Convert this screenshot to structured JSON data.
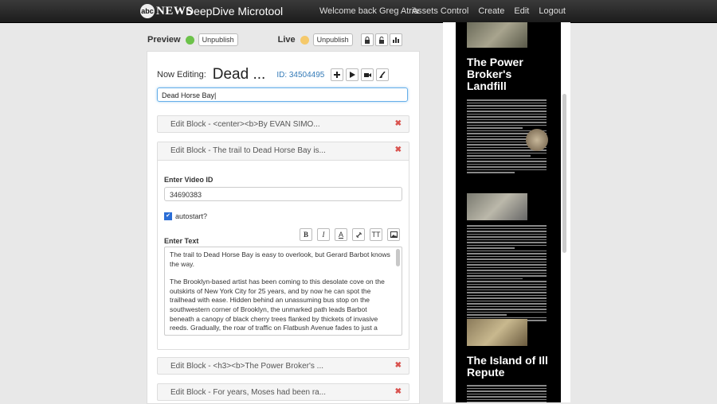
{
  "topbar": {
    "logo_mark": "abc",
    "logo_text": "NEWS",
    "app_title": "DeepDive Microtool",
    "welcome": "Welcome back Greg Atria",
    "nav": [
      "Assets Control",
      "Create",
      "Edit",
      "Logout"
    ]
  },
  "status": {
    "preview_label": "Preview",
    "preview_color": "#6cc24a",
    "live_label": "Live",
    "live_color": "#f5c96b",
    "unpublish_label": "Unpublish"
  },
  "editor": {
    "now_editing_label": "Now Editing:",
    "title_short": "Dead ...",
    "id_label": "ID: 34504495",
    "title_value": "Dead Horse Bay|"
  },
  "blocks": [
    {
      "label": "Edit Block - <center><b>By EVAN SIMO..."
    },
    {
      "label": "Edit Block - The trail to Dead Horse Bay is..."
    },
    {
      "label": "Edit Block - <h3><b>The Power Broker's ..."
    },
    {
      "label": "Edit Block - For years, Moses had been ra..."
    }
  ],
  "open_block": {
    "video_label": "Enter Video ID",
    "video_value": "34690383",
    "autostart_label": "autostart?",
    "text_label": "Enter Text",
    "format_buttons": [
      "B",
      "I",
      "A",
      "link",
      "TT",
      "image"
    ],
    "text_paragraphs": [
      "The trail to Dead Horse Bay is easy to overlook, but Gerard Barbot knows the way.",
      "The Brooklyn-based artist has been coming to this desolate cove on the outskirts of New York City for 25 years, and by now he can spot the trailhead with ease. Hidden behind an unassuming bus stop on the southwestern corner of Brooklyn, the unmarked path leads Barbot beneath a canopy of black cherry trees flanked by thickets of invasive reeds. Gradually, the roar of traffic on Flatbush Avenue fades to just a murmur as the earth under foot morphs into sand."
    ]
  },
  "preview": {
    "heading1": "The Power Broker's Landfill",
    "heading2": "The Island of Ill Repute"
  }
}
